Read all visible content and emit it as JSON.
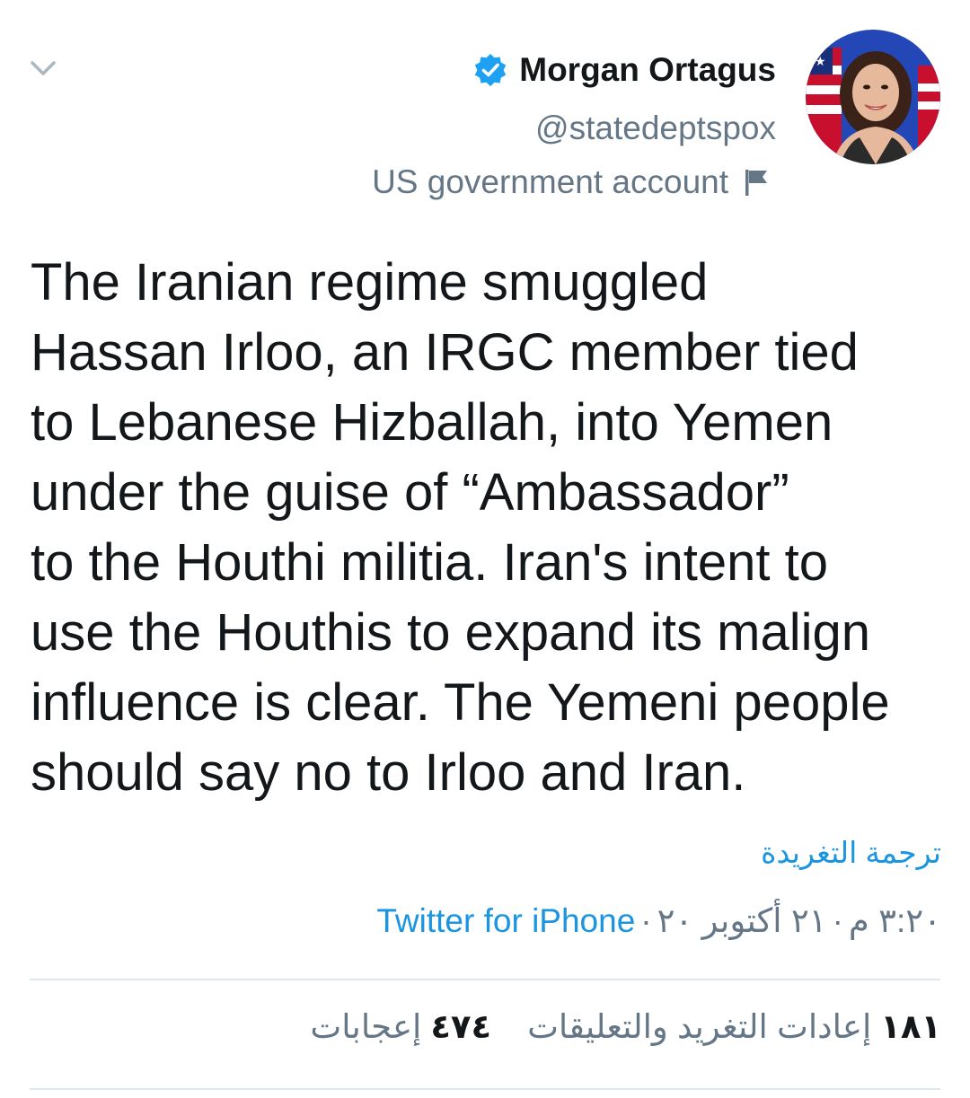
{
  "header": {
    "display_name": "Morgan Ortagus",
    "handle": "@statedeptspox",
    "account_label": "US government account"
  },
  "tweet": {
    "text": "The Iranian regime smuggled\nHassan Irloo, an IRGC member tied\nto Lebanese Hizballah, into Yemen\nunder the guise of “Ambassador”\nto the Houthi militia. Iran's intent to\nuse the Houthis to expand its malign\ninfluence is clear. The Yemeni people\nshould say no to Irloo and Iran.",
    "translate_label": "ترجمة التغريدة",
    "time": "٣:٢٠ م",
    "date": "٢١ أكتوبر ٢٠",
    "separator": "·",
    "source": "Twitter for iPhone"
  },
  "stats": {
    "retweets_count": "١٨١",
    "retweets_label": "إعادات التغريد والتعليقات",
    "likes_count": "٤٧٤",
    "likes_label": "إعجابات"
  },
  "colors": {
    "accent": "#1b95e0",
    "secondary_text": "#657786",
    "primary_text": "#14171a",
    "divider": "#e1e8ed"
  },
  "icons": {
    "menu": "chevron-down-icon",
    "verified": "verified-badge-icon",
    "flag": "flag-icon"
  }
}
